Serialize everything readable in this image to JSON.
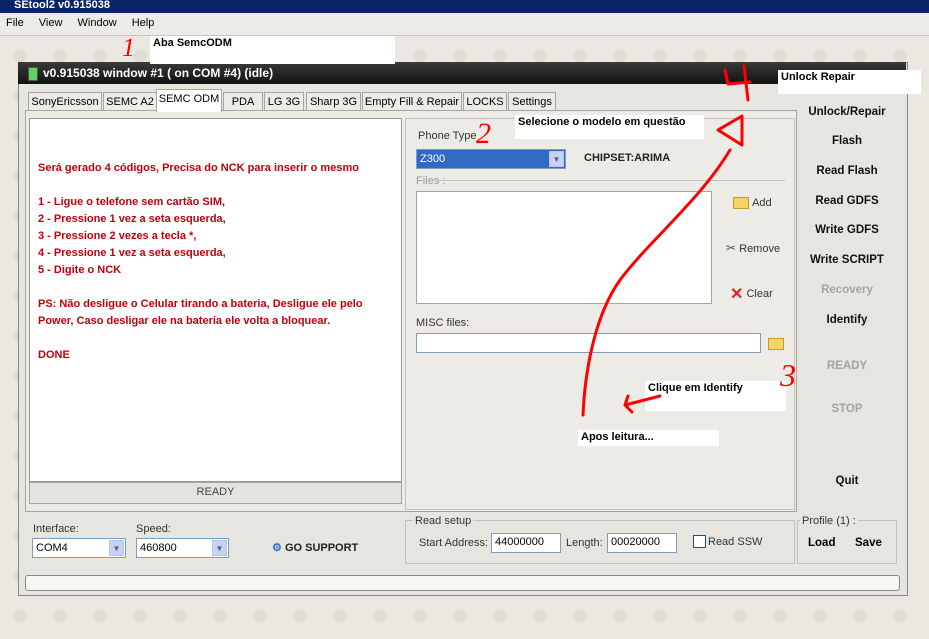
{
  "app": {
    "title": "SEtool2 v0.915038"
  },
  "menu": [
    "File",
    "View",
    "Window",
    "Help"
  ],
  "annotations": {
    "n1": "1",
    "n2": "2",
    "n3": "3",
    "n4": "4",
    "note1": "Aba SemcODM",
    "note2": "Selecione o modelo em questão",
    "note3": "Clique em Identify",
    "note4": "Unlock Repair",
    "note5": "Apos leitura..."
  },
  "window": {
    "title": "v0.915038 window #1 ( on COM #4) (idle)",
    "tabs": [
      "SonyEricsson",
      "SEMC A2",
      "SEMC ODM",
      "PDA",
      "LG 3G",
      "Sharp 3G",
      "Empty Fill & Repair",
      "LOCKS",
      "Settings"
    ],
    "active_tab": "SEMC ODM"
  },
  "log": {
    "lines": [
      "Será gerado 4 códigos, Precisa do NCK para inserir o mesmo",
      "1 - Ligue o telefone sem cartão SIM,",
      "2 - Pressione 1 vez a seta esquerda,",
      "3 - Pressione 2 vezes a tecla *,",
      "4 - Pressione 1 vez a seta esquerda,",
      "5 - Digite o NCK",
      "PS: Não desligue o Celular tirando a bateria, Desligue ele pelo",
      "Power, Caso desligar ele na bateria ele volta a bloquear.",
      "DONE"
    ],
    "status": "READY"
  },
  "phone": {
    "label": "Phone Type",
    "value": "Z300",
    "chipset": "CHIPSET:ARIMA"
  },
  "files": {
    "label": "Files :",
    "add": "Add",
    "remove": "Remove",
    "clear": "Clear",
    "misc_label": "MISC files:"
  },
  "actions": {
    "unlock": "Unlock/Repair",
    "flash": "Flash",
    "read_flash": "Read Flash",
    "read_gdfs": "Read GDFS",
    "write_gdfs": "Write GDFS",
    "write_script": "Write SCRIPT",
    "recovery": "Recovery",
    "identify": "Identify",
    "ready": "READY",
    "stop": "STOP",
    "quit": "Quit"
  },
  "bottom": {
    "interface_label": "Interface:",
    "interface_value": "COM4",
    "speed_label": "Speed:",
    "speed_value": "460800",
    "go_support": "GO SUPPORT",
    "read_setup": "Read setup",
    "start_label": "Start Address:",
    "start_value": "44000000",
    "length_label": "Length:",
    "length_value": "00020000",
    "read_ssw": "Read SSW",
    "profile": "Profile (1) :",
    "load": "Load",
    "save": "Save"
  },
  "colors": {
    "annotation_red": "#ff0000",
    "log_red": "#c3000a",
    "titlebar": "#1a1a1a"
  }
}
